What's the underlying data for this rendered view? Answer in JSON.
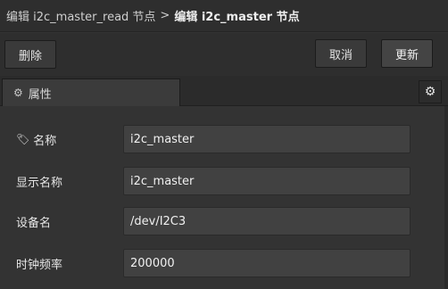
{
  "breadcrumb": {
    "parent": "编辑 i2c_master_read 节点",
    "separator": ">",
    "current": "编辑 i2c_master 节点"
  },
  "toolbar": {
    "delete_label": "删除",
    "cancel_label": "取消",
    "update_label": "更新"
  },
  "tabs": {
    "properties_label": "属性",
    "properties_icon": "gear-icon",
    "settings_icon": "gear-icon"
  },
  "form": {
    "name": {
      "label": "名称",
      "icon": "tag-icon",
      "value": "i2c_master"
    },
    "display_name": {
      "label": "显示名称",
      "value": "i2c_master"
    },
    "device_name": {
      "label": "设备名",
      "value": "/dev/I2C3"
    },
    "clock_frequency": {
      "label": "时钟频率",
      "value": "200000"
    }
  },
  "colors": {
    "background": "#333333",
    "header": "#2e2e2e",
    "input_bg": "#414141",
    "text": "#e6e6e6"
  }
}
